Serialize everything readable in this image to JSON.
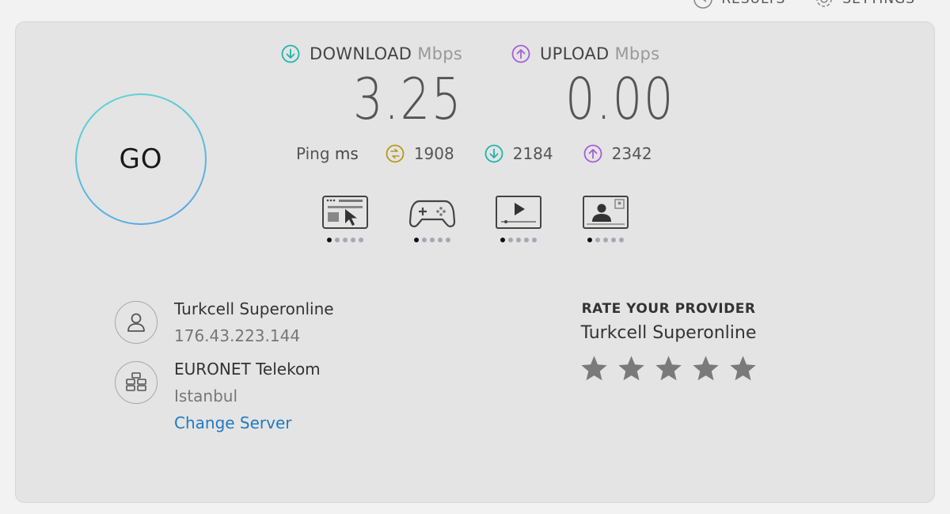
{
  "nav": {
    "results_label": "RESULTS",
    "settings_label": "SETTINGS"
  },
  "go_label": "GO",
  "download": {
    "label": "DOWNLOAD",
    "unit": "Mbps",
    "value": "3.25",
    "color": "#1fb5ad"
  },
  "upload": {
    "label": "UPLOAD",
    "unit": "Mbps",
    "value": "0.00",
    "color": "#a55ed8"
  },
  "ping": {
    "label": "Ping",
    "unit": "ms",
    "idle": "1908",
    "download": "2184",
    "upload": "2342",
    "idle_color": "#b89a1a"
  },
  "activities": [
    {
      "icon": "browsing-icon",
      "level": 1,
      "dots": 5
    },
    {
      "icon": "gaming-icon",
      "level": 1,
      "dots": 5
    },
    {
      "icon": "streaming-icon",
      "level": 1,
      "dots": 5
    },
    {
      "icon": "video-call-icon",
      "level": 1,
      "dots": 5
    }
  ],
  "provider": {
    "name": "Turkcell Superonline",
    "ip": "176.43.223.144",
    "icon": "user-icon"
  },
  "server": {
    "name": "EURONET Telekom",
    "location": "Istanbul",
    "change_label": "Change Server",
    "icon": "server-icon"
  },
  "rate": {
    "title": "RATE YOUR PROVIDER",
    "provider": "Turkcell Superonline",
    "stars": 5,
    "star_color": "#7a7a7a"
  },
  "link_color": "#1f7ac4"
}
